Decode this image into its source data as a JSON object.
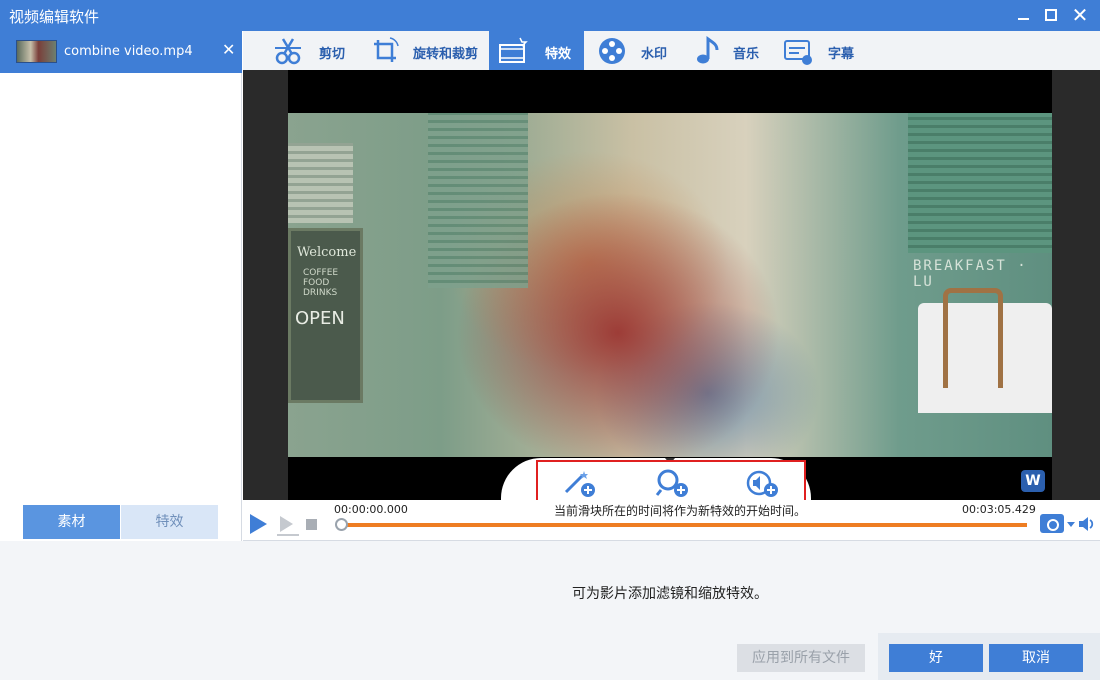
{
  "window": {
    "title": "视频编辑软件"
  },
  "file_list": {
    "items": [
      {
        "name": "combine video.mp4"
      }
    ]
  },
  "left_tabs": {
    "material": "素材",
    "effects": "特效"
  },
  "toolbar": {
    "items": [
      {
        "label": "剪切",
        "icon": "scissors-icon"
      },
      {
        "label": "旋转和裁剪",
        "icon": "rotate-crop-icon"
      },
      {
        "label": "特效",
        "icon": "film-effects-icon",
        "active": true
      },
      {
        "label": "水印",
        "icon": "watermark-icon"
      },
      {
        "label": "音乐",
        "icon": "music-note-icon"
      },
      {
        "label": "字幕",
        "icon": "subtitle-icon"
      }
    ]
  },
  "effects_tray": {
    "buttons": [
      {
        "icon": "magic-wand-add-icon"
      },
      {
        "icon": "zoom-add-icon"
      },
      {
        "icon": "audio-add-icon"
      }
    ]
  },
  "timeline": {
    "start_time": "00:00:00.000",
    "end_time": "00:03:05.429",
    "hint": "当前滑块所在的时间将作为新特效的开始时间。"
  },
  "description": "可为影片添加滤镜和缩放特效。",
  "buttons": {
    "apply_all": "应用到所有文件",
    "ok": "好",
    "cancel": "取消"
  },
  "video_signs": {
    "welcome": "Welcome",
    "menu": "COFFEE FOOD DRINKS",
    "open": "OPEN",
    "breakfast": "BREAKFAST · LU"
  },
  "colors": {
    "accent": "#3f7ed6",
    "progress": "#ee7d22",
    "highlight_box": "#e02020"
  }
}
